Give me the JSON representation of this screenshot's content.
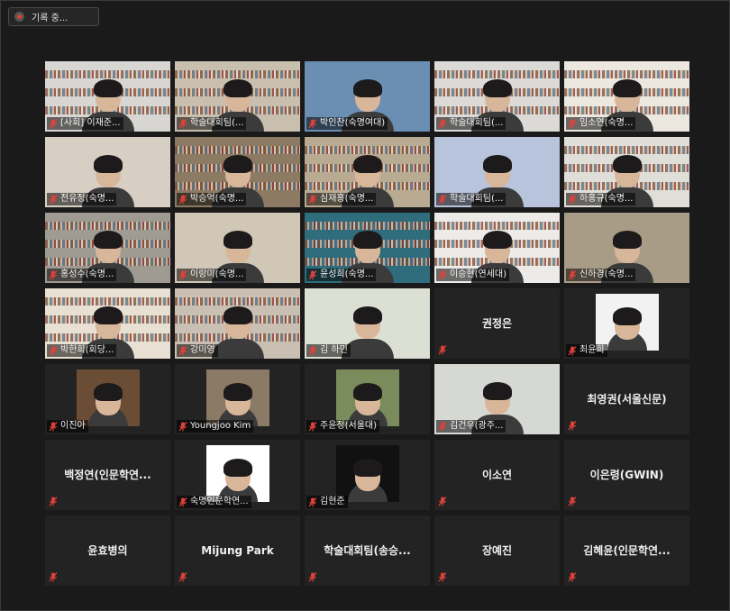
{
  "recording": {
    "label": "기록 중..."
  },
  "tiles": [
    {
      "name": "[사회] 이재준...",
      "type": "camera",
      "bg": "#d8d6d2",
      "active": false
    },
    {
      "name": "학술대회팀(...",
      "type": "camera",
      "bg": "#c9bfae",
      "active": false
    },
    {
      "name": "박인찬(숙명여대)",
      "type": "camera",
      "bg": "#6b8fb3",
      "active": true
    },
    {
      "name": "학술대회팀(...",
      "type": "camera",
      "bg": "#dcdad6",
      "active": false
    },
    {
      "name": "임소연(숙명...",
      "type": "camera",
      "bg": "#ece8e0",
      "active": false
    },
    {
      "name": "전유정(숙명...",
      "type": "camera",
      "bg": "#d7cfc3",
      "active": false
    },
    {
      "name": "박승억(숙명...",
      "type": "camera",
      "bg": "#8c7a62",
      "active": false
    },
    {
      "name": "심재홍(숙명...",
      "type": "camera",
      "bg": "#b9aa92",
      "active": false
    },
    {
      "name": "학술대회팀(...",
      "type": "camera",
      "bg": "#b8c4dc",
      "active": false
    },
    {
      "name": "하홍규(숙명...",
      "type": "camera",
      "bg": "#e0ded9",
      "active": false
    },
    {
      "name": "홍성수(숙명...",
      "type": "camera",
      "bg": "#9f9a92",
      "active": false
    },
    {
      "name": "이랑미(숙명...",
      "type": "camera",
      "bg": "#d0c7b6",
      "active": false
    },
    {
      "name": "윤성희(숙명...",
      "type": "camera",
      "bg": "#2f6d7d",
      "active": false
    },
    {
      "name": "이승현(연세대)",
      "type": "camera",
      "bg": "#ecebe8",
      "active": false
    },
    {
      "name": "신하경(숙명...",
      "type": "camera",
      "bg": "#a99c86",
      "active": false
    },
    {
      "name": "박한희(회당...",
      "type": "camera",
      "bg": "#e8e0d2",
      "active": false
    },
    {
      "name": "강미영",
      "type": "camera",
      "bg": "#c9bfb2",
      "active": false
    },
    {
      "name": "김 하민",
      "type": "camera",
      "bg": "#dcdfd4",
      "active": false
    },
    {
      "name": "권정은",
      "type": "name"
    },
    {
      "name": "최윤희",
      "type": "photo",
      "bg": "#f2f2f2"
    },
    {
      "name": "이진아",
      "type": "photo",
      "bg": "#6b4d36"
    },
    {
      "name": "Youngjoo Kim",
      "type": "photo",
      "bg": "#8a7a66"
    },
    {
      "name": "주윤정(서울대)",
      "type": "photo",
      "bg": "#7b8c5c"
    },
    {
      "name": "김건우(광주...",
      "type": "camera",
      "bg": "#d6d8d4",
      "active": false
    },
    {
      "name": "최영권(서울신문)",
      "type": "name"
    },
    {
      "name": "백정연(인문학연...",
      "type": "name"
    },
    {
      "name": "숙명인문학연...",
      "type": "photo",
      "bg": "#ffffff"
    },
    {
      "name": "김현준",
      "type": "photo",
      "bg": "#111111"
    },
    {
      "name": "이소연",
      "type": "name"
    },
    {
      "name": "이은령(GWIN)",
      "type": "name"
    },
    {
      "name": "윤효병의",
      "type": "name"
    },
    {
      "name": "Mijung Park",
      "type": "name"
    },
    {
      "name": "학술대회팀(송승...",
      "type": "name"
    },
    {
      "name": "장예진",
      "type": "name"
    },
    {
      "name": "김혜윤(인문학연...",
      "type": "name"
    }
  ],
  "icons": {
    "muted": "mic-muted-icon",
    "recording": "recording-dot-icon"
  },
  "colors": {
    "active_speaker": "#cfd63a",
    "muted": "#e0413a",
    "tile_bg": "#232323"
  }
}
